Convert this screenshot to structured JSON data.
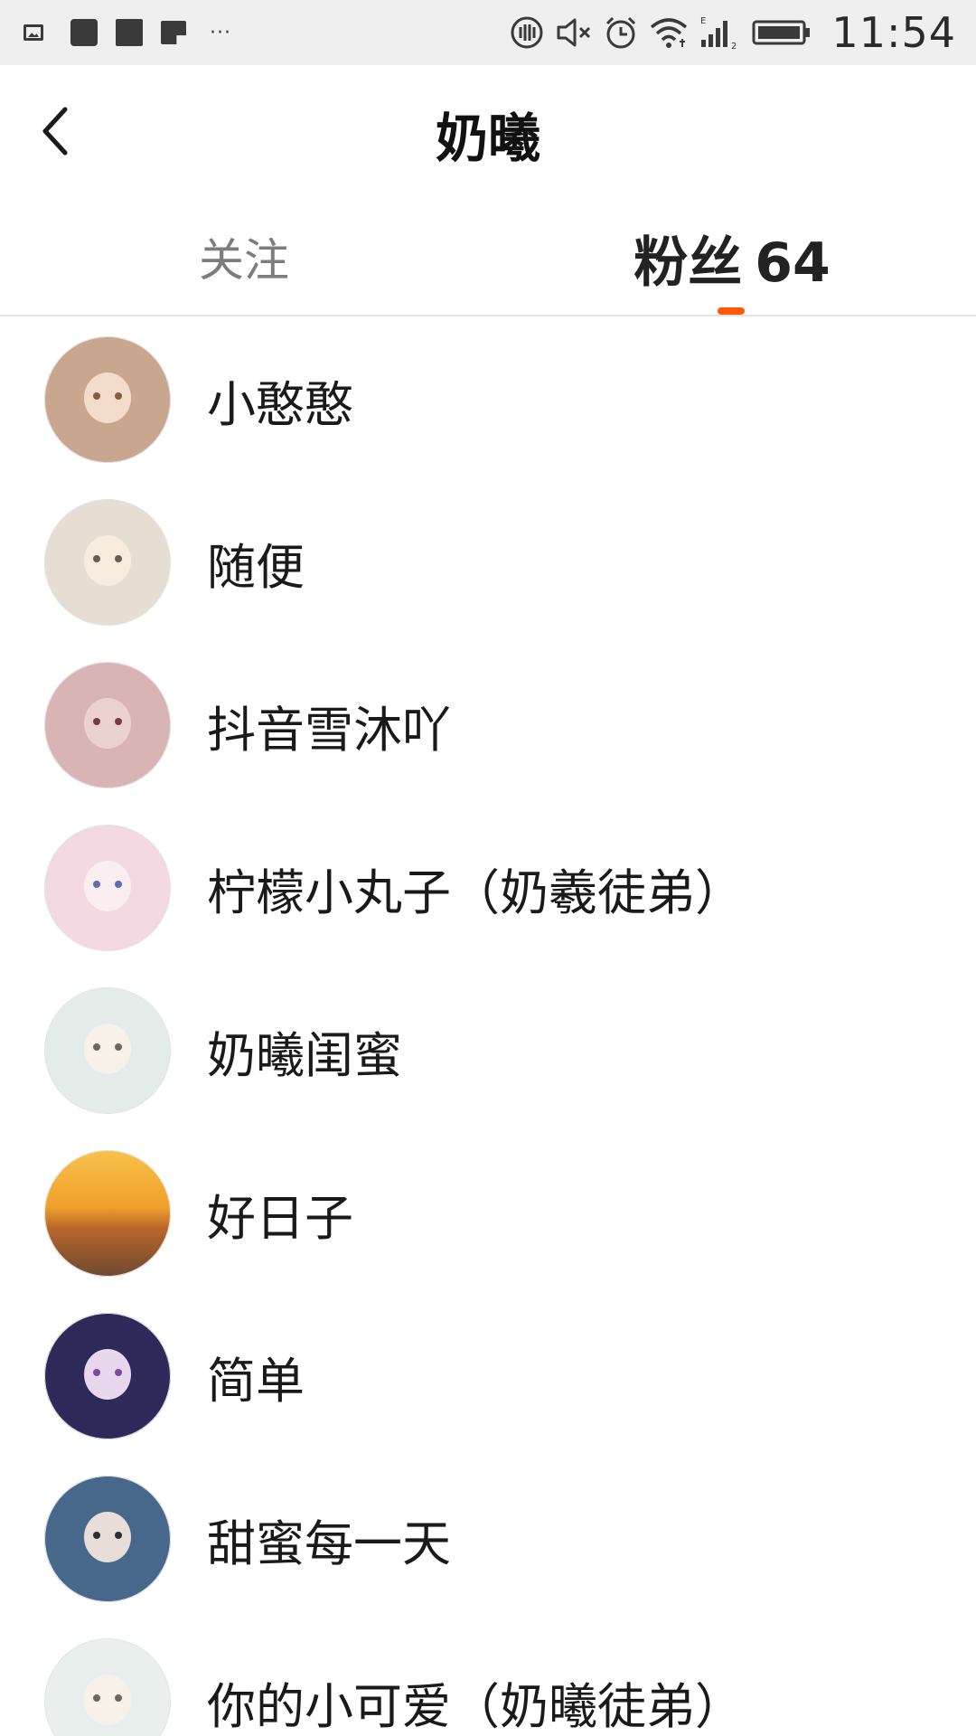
{
  "status_bar": {
    "time": "11:54",
    "left_icons": [
      "image-icon",
      "app-icon",
      "app-icon",
      "app-icon"
    ],
    "overflow_dots": "···",
    "right_icons": [
      "nfc-icon",
      "mute-icon",
      "alarm-icon",
      "wifi-icon",
      "signal-icon",
      "battery-icon"
    ]
  },
  "header": {
    "title": "奶曦",
    "back_icon": "chevron-left-icon"
  },
  "tabs": [
    {
      "label": "关注",
      "count": "",
      "active": false
    },
    {
      "label": "粉丝",
      "count": "64",
      "active": true
    }
  ],
  "colors": {
    "accent": "#ff5a0a",
    "text_primary": "#1a1a1a",
    "text_secondary": "#7d7d7d",
    "status_bar_bg": "#efefef",
    "divider": "#e6e6e6"
  },
  "followers": [
    {
      "name": "小憨憨",
      "avatar": {
        "bg": "#c9a78f",
        "face": "#f4dccb",
        "eye": "#8a5a3c"
      }
    },
    {
      "name": "随便",
      "avatar": {
        "bg": "#e6ded3",
        "face": "#f8ece0",
        "eye": "#6d5b4b"
      }
    },
    {
      "name": "抖音雪沐吖",
      "avatar": {
        "bg": "#d9b4b4",
        "face": "#ecd2cf",
        "eye": "#7a3b47"
      }
    },
    {
      "name": "柠檬小丸子（奶羲徒弟）",
      "avatar": {
        "bg": "#f3d9e2",
        "face": "#fbeef0",
        "eye": "#5a6fb0"
      }
    },
    {
      "name": "奶曦闺蜜",
      "avatar": {
        "bg": "#e3ece9",
        "face": "#f7f1ea",
        "eye": "#6e6a58"
      }
    },
    {
      "name": "好日子",
      "avatar": {
        "bg": "#e6a23a",
        "face": "",
        "eye": ""
      }
    },
    {
      "name": "简单",
      "avatar": {
        "bg": "#2d2a5a",
        "face": "#e9d7ee",
        "eye": "#7e4aa0"
      }
    },
    {
      "name": "甜蜜每一天",
      "avatar": {
        "bg": "#47688a",
        "face": "#e8ded8",
        "eye": "#2d2d3a"
      }
    },
    {
      "name": "你的小可爱（奶曦徒弟）",
      "avatar": {
        "bg": "#e8efec",
        "face": "#f7f1ea",
        "eye": "#6e6a58"
      }
    }
  ]
}
